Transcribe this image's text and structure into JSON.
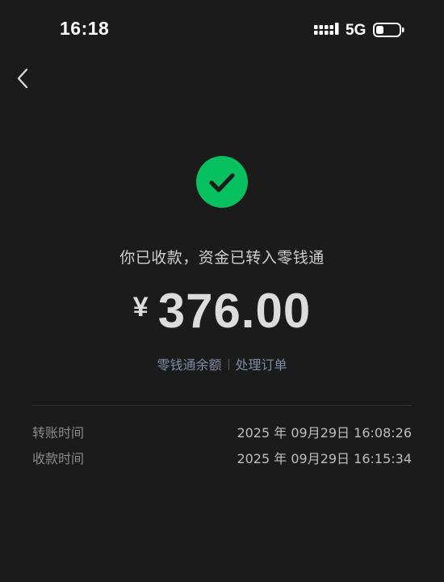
{
  "status_bar": {
    "time": "16:18",
    "network": "5G",
    "icons": [
      "signal-icon",
      "battery-icon"
    ]
  },
  "nav": {
    "back_icon": "chevron-left-icon"
  },
  "result": {
    "icon": "check-circle-icon",
    "icon_color": "#07c160",
    "message": "你已收款，资金已转入零钱通",
    "currency": "¥",
    "amount": "376.00"
  },
  "links": {
    "balance": "零钱通余额",
    "process_order": "处理订单",
    "link_color": "#7d8ba3"
  },
  "details": [
    {
      "label": "转账时间",
      "value": "2025 年 09月29日 16:08:26"
    },
    {
      "label": "收款时间",
      "value": "2025 年 09月29日 16:15:34"
    }
  ]
}
